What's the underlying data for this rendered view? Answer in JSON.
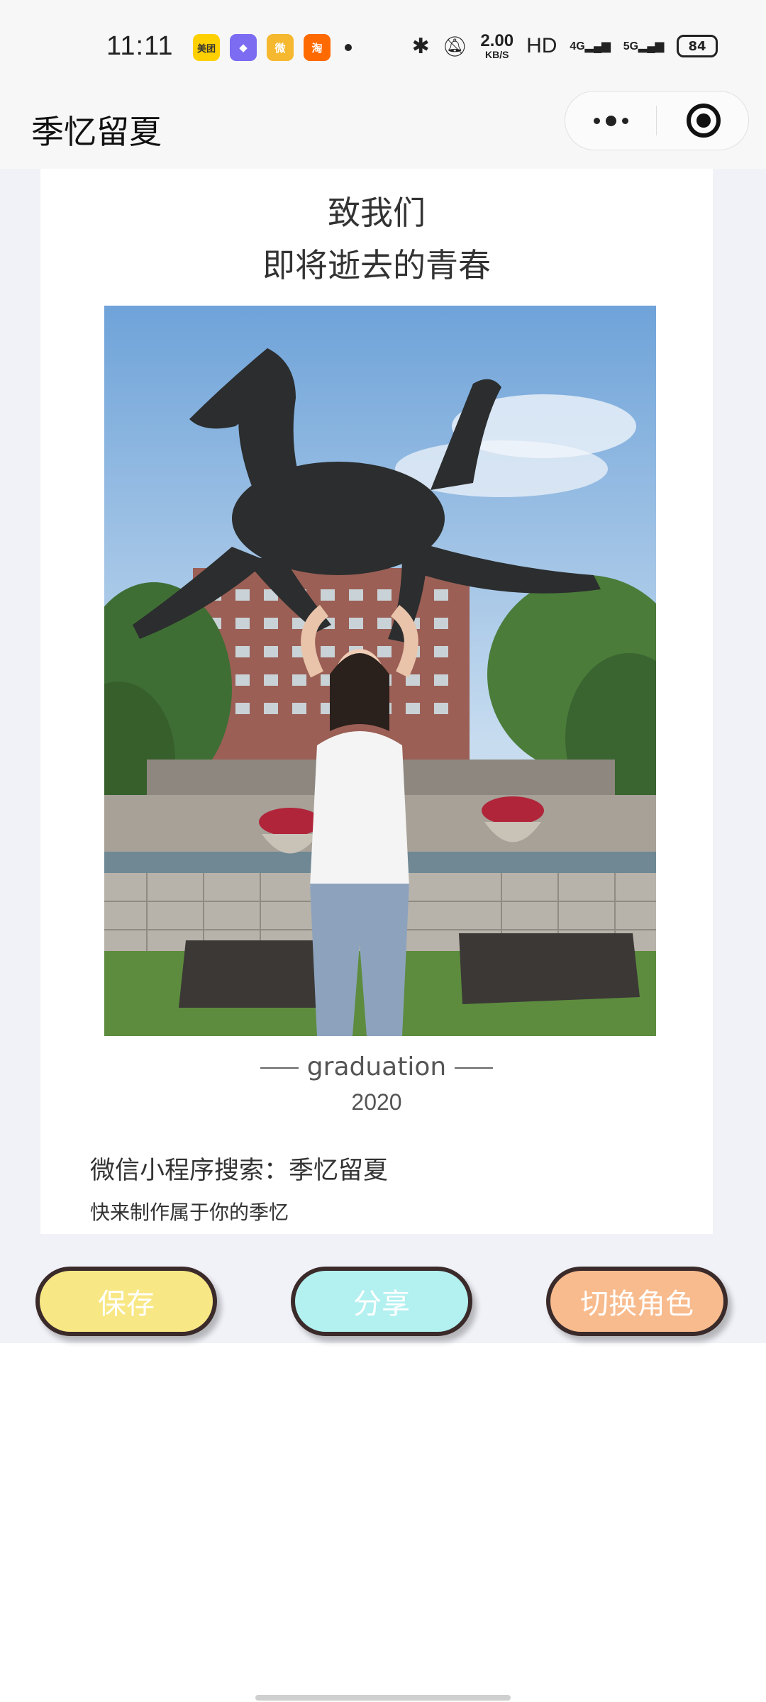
{
  "status_bar": {
    "time": "11:11",
    "apps": [
      {
        "name": "meituan-icon",
        "label": "美团",
        "color": "#ffd000"
      },
      {
        "name": "kuaipan-icon",
        "label": "◆",
        "color": "#7b6cf2"
      },
      {
        "name": "weibo-icon",
        "label": "微",
        "color": "#f5b82e"
      },
      {
        "name": "taobao-icon",
        "label": "淘",
        "color": "#ff6a00"
      }
    ],
    "net_speed_value": "2.00",
    "net_speed_unit": "KB/S",
    "hd": "HD",
    "sig1": "4G",
    "sig2": "5G",
    "battery": "84"
  },
  "navbar": {
    "title": "季忆留夏"
  },
  "card": {
    "heading_line1": "致我们",
    "heading_line2": "即将逝去的青春",
    "caption_word": "graduation",
    "caption_year": "2020",
    "promo_line1": "微信小程序搜索：季忆留夏",
    "promo_line2": "快来制作属于你的季忆"
  },
  "buttons": {
    "save": "保存",
    "share": "分享",
    "switch_role": "切换角色"
  },
  "colors": {
    "save_btn": "#f8e785",
    "share_btn": "#b3f0f0",
    "role_btn": "#f8bb8d",
    "page_bg": "#f1f2f8"
  }
}
